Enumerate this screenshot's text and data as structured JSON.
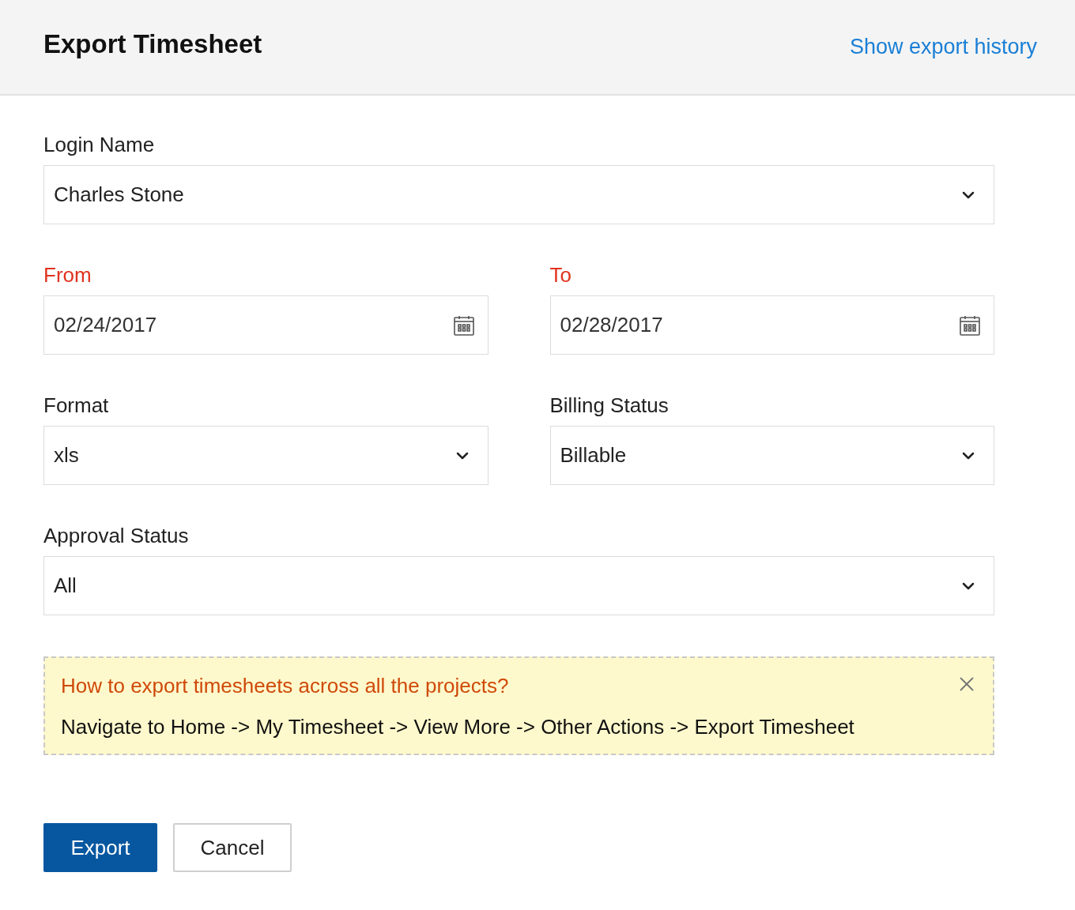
{
  "header": {
    "title": "Export Timesheet",
    "link": "Show export history"
  },
  "rows": [
    {
      "fields": [
        {
          "label": "Login Name",
          "required": false,
          "kind": "select",
          "value": "Charles Stone"
        }
      ]
    },
    {
      "fields": [
        {
          "label": "From",
          "required": true,
          "kind": "date",
          "value": "02/24/2017"
        },
        {
          "label": "To",
          "required": true,
          "kind": "date",
          "value": "02/28/2017"
        }
      ]
    },
    {
      "fields": [
        {
          "label": "Format",
          "required": false,
          "kind": "select",
          "value": "xls"
        },
        {
          "label": "Billing Status",
          "required": false,
          "kind": "select",
          "value": "Billable"
        }
      ]
    },
    {
      "fields": [
        {
          "label": "Approval Status",
          "required": false,
          "kind": "select",
          "value": "All"
        }
      ]
    }
  ],
  "tip": {
    "question": "How to export timesheets across all the projects?",
    "answer": "Navigate to Home -> My Timesheet -> View More -> Other Actions -> Export Timesheet"
  },
  "buttons": [
    {
      "label": "Export",
      "kind": "primary"
    },
    {
      "label": "Cancel",
      "kind": "secondary"
    }
  ]
}
